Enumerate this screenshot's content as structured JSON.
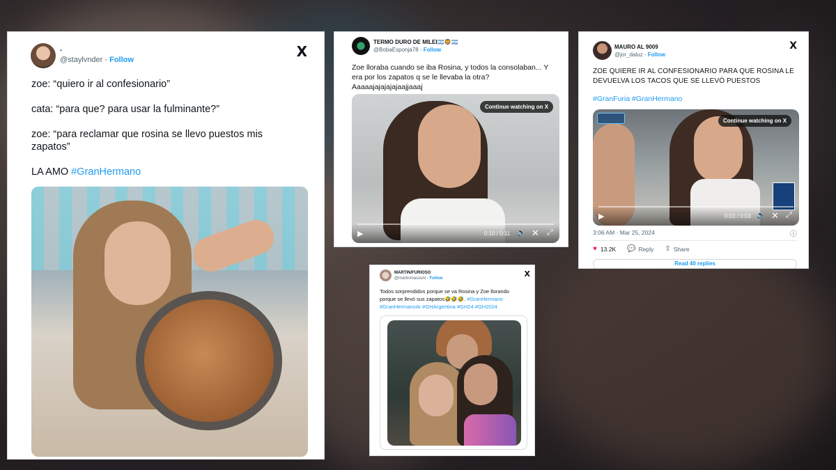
{
  "tweets": [
    {
      "display_name": "·",
      "handle": "@staylvnder",
      "follow_label": "Follow",
      "x_logo": "X",
      "lines": [
        "zoe: “quiero ir al confesionario”",
        "cata: “para que? para usar la fulminante?”",
        "zoe: “para reclamar que rosina se llevo puestos mis zapatos”"
      ],
      "closing_text": "LA AMO",
      "hashtag": "#GranHermano"
    },
    {
      "display_name": "TERMO DURO DE MILEI🇦🇷🦁🇦🇷",
      "handle": "@BobaEsponja78",
      "follow_label": "Follow",
      "x_logo": "X",
      "text": "Zoe lloraba cuando se iba Rosina, y todos la consolaban... Y era por los zapatos q se le llevaba la otra? Aaaaajajajajajaajjaaaj",
      "continue_label": "Continue watching on X",
      "time": "0:10 / 0:11"
    },
    {
      "display_name": "MAURO AL 9009",
      "handle": "@jor_daluz",
      "follow_label": "Follow",
      "x_logo": "X",
      "text": "ZOE QUIERE IR AL CONFESIONARIO PARA QUE ROSINA LE DEVUELVA LOS TACOS QUE SE LLEVÓ PUESTOS",
      "hashtags": "#GranFuria #GranHermano",
      "continue_label": "Continue watching on X",
      "time": "0:03 / 0:03",
      "timestamp": "3:06 AM · Mar 25, 2024",
      "likes": "13.2K",
      "reply_label": "Reply",
      "share_label": "Share",
      "read_replies": "Read 40 replies"
    },
    {
      "display_name": "MARTIN/FURIOSO",
      "handle": "@martinmassoni",
      "follow_label": "Follow",
      "x_logo": "X",
      "text": "Todos sorprendidos porque se va Rosina y Zoe llorando porque se llevó sus zapatos🤣🤣🤣.",
      "hashtags": "#GranHermano #GranHermanoAr #GHArgentina #GH24 #GH2024"
    }
  ],
  "colors": {
    "link": "#1d9bf0",
    "like": "#f91880",
    "text": "#0f1419",
    "muted": "#536471"
  }
}
